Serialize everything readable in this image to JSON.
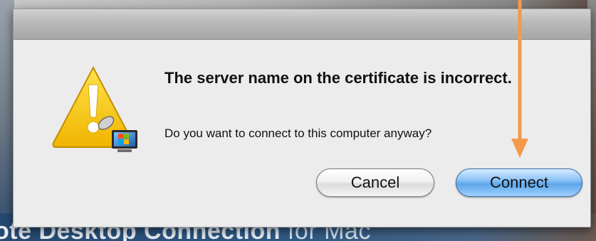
{
  "dialog": {
    "title": "The server name on the certificate is incorrect.",
    "message": "Do you want to connect to this computer anyway?",
    "icon": "warning-icon",
    "buttons": {
      "cancel_label": "Cancel",
      "connect_label": "Connect"
    }
  },
  "background": {
    "app_title_bold": "ote Desktop Connection",
    "app_title_light": "for Mac"
  },
  "annotation": {
    "arrow_color": "#f39a4a"
  },
  "colors": {
    "default_button": "#5ea6ea",
    "warning": "#f2c200"
  }
}
